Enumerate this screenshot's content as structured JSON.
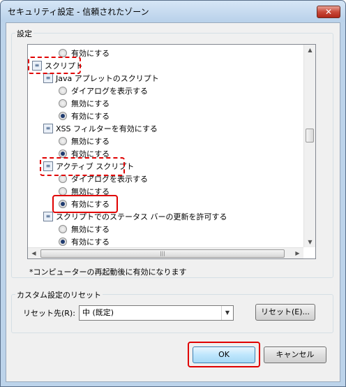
{
  "window": {
    "title": "セキュリティ設定 - 信頼されたゾーン",
    "close_glyph": "✕"
  },
  "settings": {
    "group_label": "設定",
    "tree": [
      {
        "kind": "radio",
        "label": "有効にする",
        "checked": false
      },
      {
        "kind": "category",
        "label": "スクリプト"
      },
      {
        "kind": "setting",
        "label": "Java アプレットのスクリプト"
      },
      {
        "kind": "radio",
        "label": "ダイアログを表示する",
        "checked": false
      },
      {
        "kind": "radio",
        "label": "無効にする",
        "checked": false
      },
      {
        "kind": "radio",
        "label": "有効にする",
        "checked": true
      },
      {
        "kind": "setting",
        "label": "XSS フィルターを有効にする"
      },
      {
        "kind": "radio",
        "label": "無効にする",
        "checked": false
      },
      {
        "kind": "radio",
        "label": "有効にする",
        "checked": true
      },
      {
        "kind": "setting",
        "label": "アクティブ スクリプト"
      },
      {
        "kind": "radio",
        "label": "ダイアログを表示する",
        "checked": false
      },
      {
        "kind": "radio",
        "label": "無効にする",
        "checked": false
      },
      {
        "kind": "radio",
        "label": "有効にする",
        "checked": true
      },
      {
        "kind": "setting",
        "label": "スクリプトでのステータス バーの更新を許可する"
      },
      {
        "kind": "radio",
        "label": "無効にする",
        "checked": false
      },
      {
        "kind": "radio",
        "label": "有効にする",
        "checked": true
      }
    ],
    "note": "*コンピューターの再起動後に有効になります"
  },
  "reset": {
    "group_label": "カスタム設定のリセット",
    "reset_to_label": "リセット先(R):",
    "selected": "中 (既定)",
    "reset_button": "リセット(E)..."
  },
  "buttons": {
    "ok": "OK",
    "cancel": "キャンセル"
  },
  "icons": {
    "setting_icon": "script-settings-icon",
    "scroll_up": "▲",
    "scroll_down": "▼",
    "scroll_left": "◀",
    "scroll_right": "▶",
    "grip": "|||",
    "dropdown": "▼"
  },
  "colors": {
    "highlight_red": "#e00000",
    "radio_dot": "#1f3b6f"
  }
}
